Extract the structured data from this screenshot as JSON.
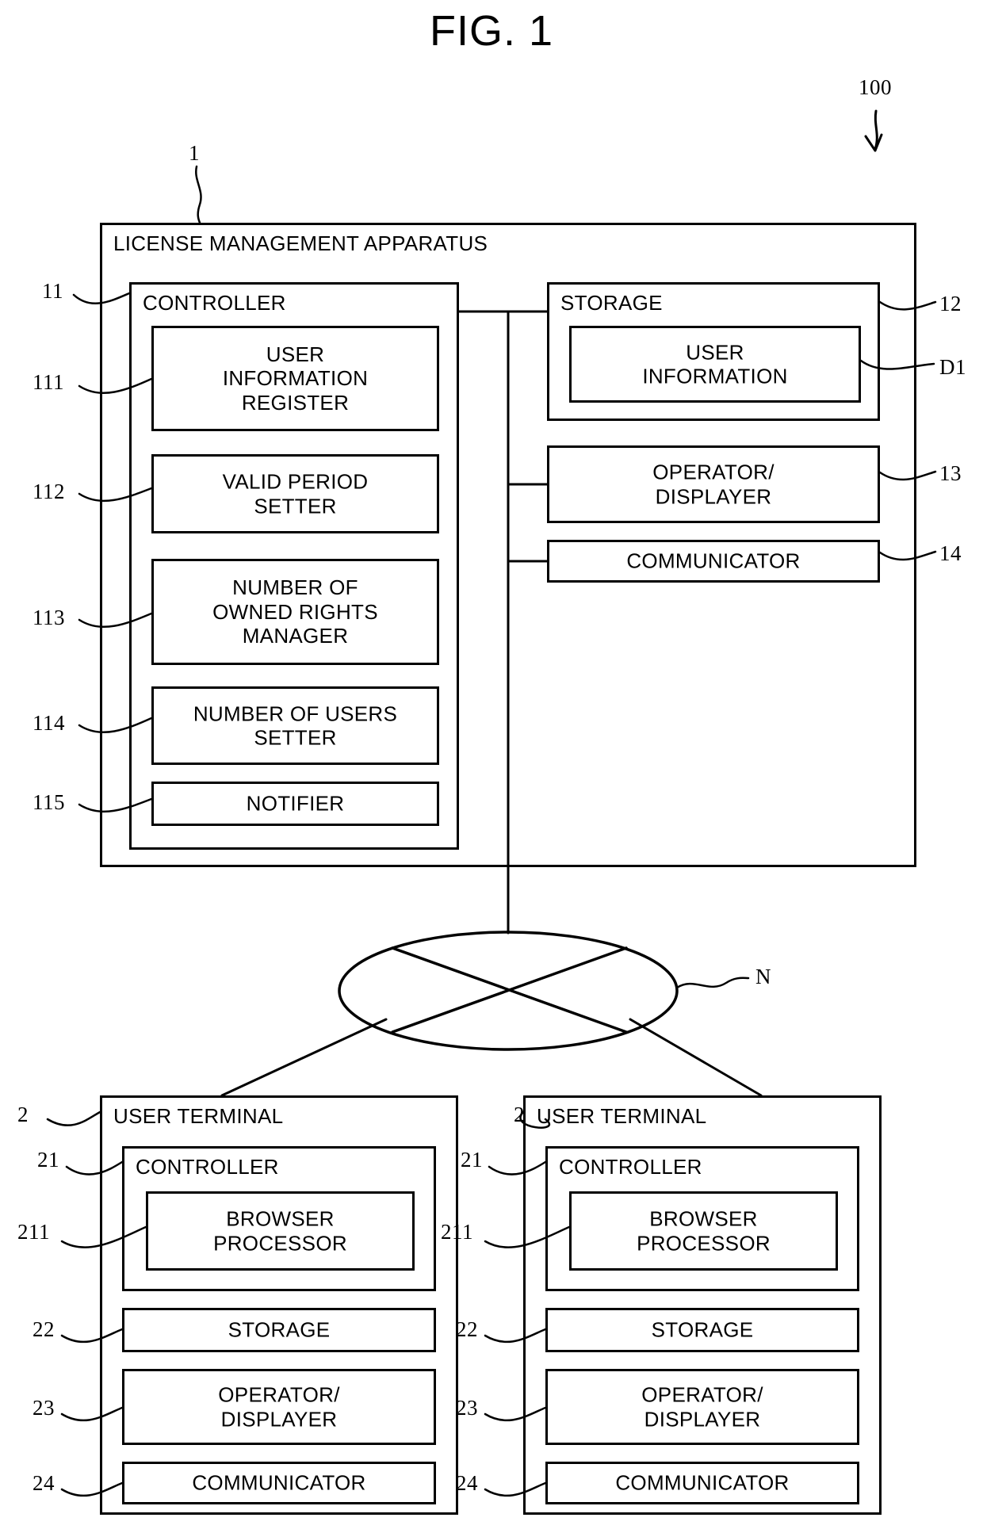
{
  "figure": {
    "title": "FIG. 1",
    "system_ref": "100"
  },
  "license_management_apparatus": {
    "ref": "1",
    "label": "LICENSE MANAGEMENT APPARATUS",
    "controller": {
      "ref": "11",
      "label": "CONTROLLER",
      "modules": [
        {
          "ref": "111",
          "lines": [
            "USER",
            "INFORMATION",
            "REGISTER"
          ]
        },
        {
          "ref": "112",
          "lines": [
            "VALID PERIOD",
            "SETTER"
          ]
        },
        {
          "ref": "113",
          "lines": [
            "NUMBER OF",
            "OWNED RIGHTS",
            "MANAGER"
          ]
        },
        {
          "ref": "114",
          "lines": [
            "NUMBER OF USERS",
            "SETTER"
          ]
        },
        {
          "ref": "115",
          "lines": [
            "NOTIFIER"
          ]
        }
      ]
    },
    "storage": {
      "ref": "12",
      "label": "STORAGE",
      "data": {
        "ref": "D1",
        "lines": [
          "USER",
          "INFORMATION"
        ]
      }
    },
    "operator_displayer": {
      "ref": "13",
      "lines": [
        "OPERATOR/",
        "DISPLAYER"
      ]
    },
    "communicator": {
      "ref": "14",
      "lines": [
        "COMMUNICATOR"
      ]
    }
  },
  "network": {
    "ref": "N",
    "shape": "ellipse-with-cross"
  },
  "user_terminals": [
    {
      "ref": "2",
      "label": "USER TERMINAL",
      "controller": {
        "ref": "21",
        "label": "CONTROLLER",
        "browser_processor": {
          "ref": "211",
          "lines": [
            "BROWSER",
            "PROCESSOR"
          ]
        }
      },
      "storage": {
        "ref": "22",
        "lines": [
          "STORAGE"
        ]
      },
      "operator_displayer": {
        "ref": "23",
        "lines": [
          "OPERATOR/",
          "DISPLAYER"
        ]
      },
      "communicator": {
        "ref": "24",
        "lines": [
          "COMMUNICATOR"
        ]
      }
    },
    {
      "ref": "2",
      "label": "USER TERMINAL",
      "controller": {
        "ref": "21",
        "label": "CONTROLLER",
        "browser_processor": {
          "ref": "211",
          "lines": [
            "BROWSER",
            "PROCESSOR"
          ]
        }
      },
      "storage": {
        "ref": "22",
        "lines": [
          "STORAGE"
        ]
      },
      "operator_displayer": {
        "ref": "23",
        "lines": [
          "OPERATOR/",
          "DISPLAYER"
        ]
      },
      "communicator": {
        "ref": "24",
        "lines": [
          "COMMUNICATOR"
        ]
      }
    }
  ],
  "colors": {
    "line": "#000000",
    "background": "#ffffff"
  }
}
